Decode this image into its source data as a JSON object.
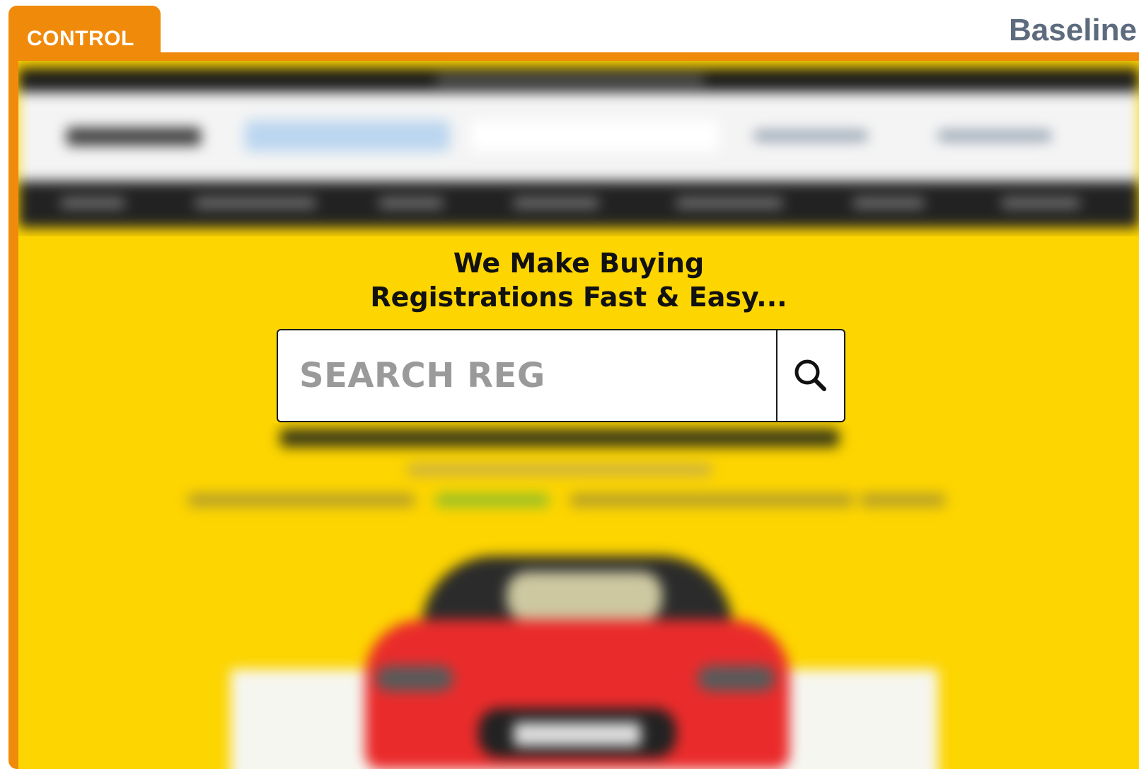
{
  "tab": {
    "label": "CONTROL"
  },
  "variant": {
    "label": "Baseline"
  },
  "hero": {
    "headline_line1": "We Make Buying",
    "headline_line2": "Registrations Fast & Easy..."
  },
  "search": {
    "placeholder": "SEARCH REG",
    "value": "",
    "icon": "search-icon"
  },
  "colors": {
    "accent_orange": "#F08A0B",
    "hero_yellow": "#FDD500",
    "label_gray": "#5C6B7D"
  }
}
